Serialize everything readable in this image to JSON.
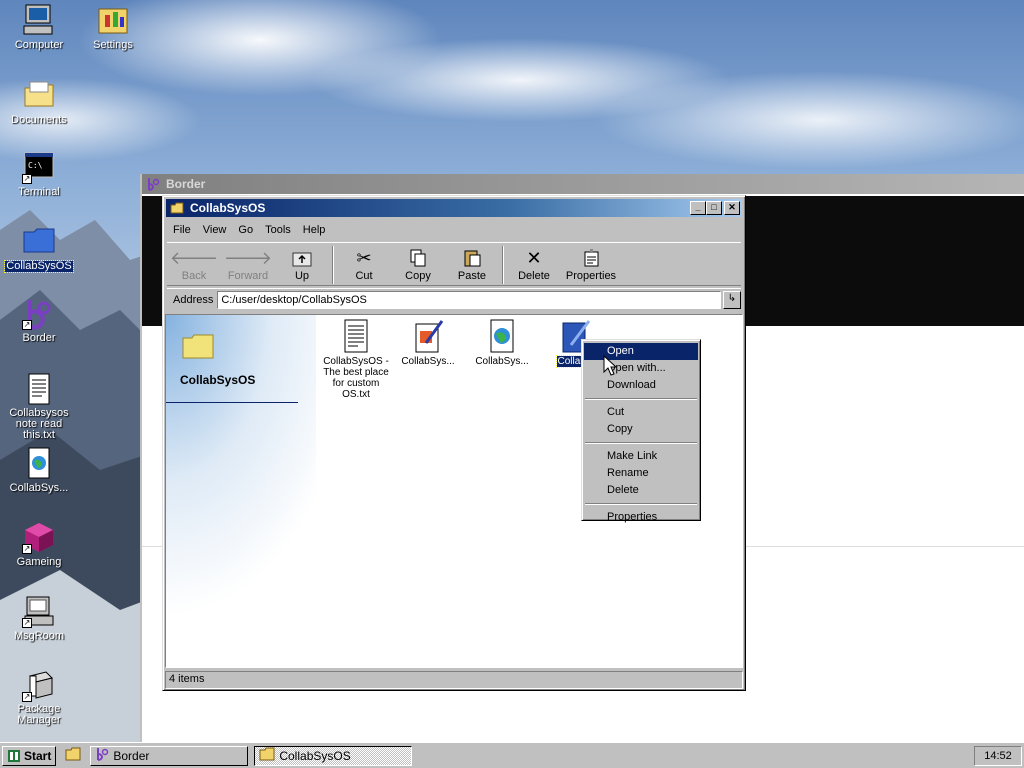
{
  "desktop": {
    "icons": [
      {
        "label": "Computer"
      },
      {
        "label": "Settings"
      },
      {
        "label": "Documents"
      },
      {
        "label": "Terminal"
      },
      {
        "label": "CollabSysOS"
      },
      {
        "label": "Border"
      },
      {
        "label": "Collabsysos note read this.txt"
      },
      {
        "label": "CollabSys..."
      },
      {
        "label": "Gameing"
      },
      {
        "label": "MsgRoom"
      },
      {
        "label": "Package Manager"
      }
    ]
  },
  "border_window": {
    "title": "Border"
  },
  "explorer": {
    "title": "CollabSysOS",
    "title_buttons": {
      "minimize": "_",
      "maximize": "□",
      "close": "✕"
    },
    "menu": [
      "File",
      "View",
      "Go",
      "Tools",
      "Help"
    ],
    "toolbar": {
      "back": "Back",
      "forward": "Forward",
      "up": "Up",
      "cut": "Cut",
      "copy": "Copy",
      "paste": "Paste",
      "delete": "Delete",
      "properties": "Properties"
    },
    "address": {
      "label": "Address",
      "value": "C:/user/desktop/CollabSysOS"
    },
    "side_panel_title": "CollabSysOS",
    "files": [
      {
        "label": "CollabSysOS - The best place for custom OS.txt",
        "icon": "text-file-icon"
      },
      {
        "label": "CollabSys...",
        "icon": "edit-document-icon"
      },
      {
        "label": "CollabSys...",
        "icon": "web-document-icon"
      },
      {
        "label": "CollabS",
        "icon": "blue-document-icon",
        "selected": true
      }
    ],
    "status": "4 items"
  },
  "context_menu": {
    "items": [
      "Open",
      "Open with...",
      "Download",
      "Cut",
      "Copy",
      "Make Link",
      "Rename",
      "Delete",
      "Properties"
    ]
  },
  "taskbar": {
    "start": "Start",
    "tasks": [
      "Border",
      "CollabSysOS"
    ],
    "clock": "14:52"
  }
}
